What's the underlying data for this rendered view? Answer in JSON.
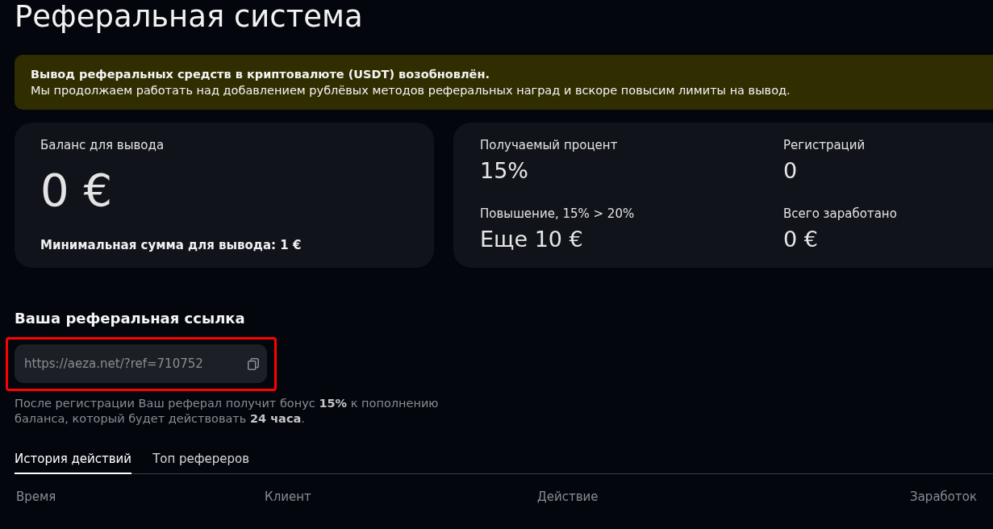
{
  "page": {
    "title": "Реферальная система"
  },
  "notice": {
    "heading": "Вывод реферальных средств в криптовалюте (USDT) возобновлён.",
    "text": "Мы продолжаем работать над добавлением рублёвых методов реферальных наград и вскоре повысим лимиты на вывод."
  },
  "balance_card": {
    "label": "Баланс для вывода",
    "value": "0 €",
    "note": "Минимальная сумма для вывода: 1 €"
  },
  "stats": [
    {
      "label": "Получаемый процент",
      "value": "15%"
    },
    {
      "label": "Регистраций",
      "value": "0"
    },
    {
      "label": "Повышение, 15% > 20%",
      "value": "Еще 10 €"
    },
    {
      "label": "Всего заработано",
      "value": "0 €"
    }
  ],
  "referral_link": {
    "title": "Ваша реферальная ссылка",
    "value": "https://aeza.net/?ref=710752",
    "highlighted": true,
    "note": "После регистрации Ваш реферал получит бонус **15%** к пополнению баланса, который будет действовать **24 часа**."
  },
  "tabs": [
    {
      "label": "История действий",
      "selected": true
    },
    {
      "label": "Топ рефереров",
      "selected": false
    }
  ],
  "table": {
    "columns": [
      "Время",
      "Клиент",
      "Действие",
      "Заработок"
    ]
  }
}
